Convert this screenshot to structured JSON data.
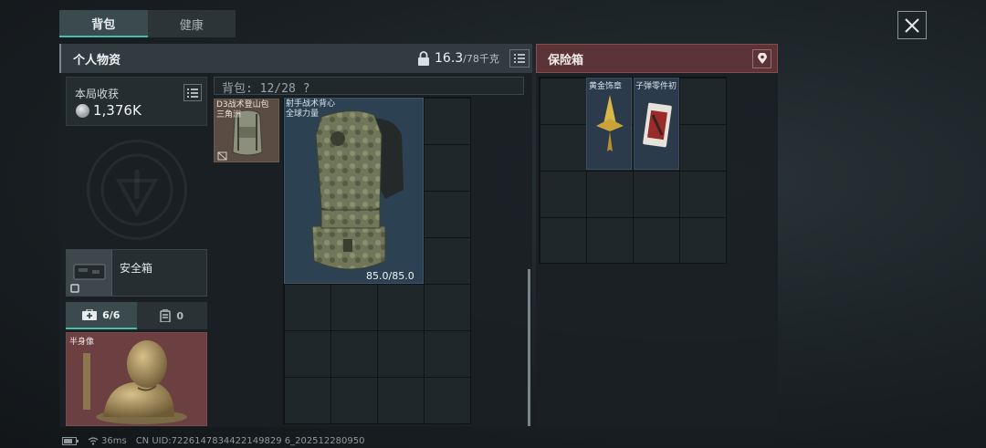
{
  "tabs": {
    "inventory": "背包",
    "health": "健康"
  },
  "personal": {
    "title": "个人物资",
    "weight_current": "16.3",
    "weight_max": "/78千克"
  },
  "loot": {
    "label": "本局收获",
    "value": "1,376K"
  },
  "safe_case": {
    "label": "安全箱"
  },
  "sub_tabs": {
    "medical": "6/6",
    "ammo": "0"
  },
  "bust": {
    "label": "半身像"
  },
  "backpack": {
    "label": "背包: 12/28 ?",
    "bag_item": {
      "line1": "D3战术登山包",
      "line2": "三角洲"
    },
    "vest_item": {
      "line1": "射手战术背心",
      "line2": "全球力量",
      "durability": "85.0/85.0"
    }
  },
  "safe_box": {
    "title": "保险箱",
    "items": [
      {
        "label": "黄金饰章"
      },
      {
        "label": "子弹零件初"
      }
    ]
  },
  "status": {
    "ping": "36ms",
    "uid": "CN UID:7226147834422149829 6_202512280950"
  },
  "colors": {
    "accent": "#45c0a8",
    "safe_header": "#5a3436",
    "item_blue": "#2c4252",
    "item_red": "#6c3f40"
  }
}
